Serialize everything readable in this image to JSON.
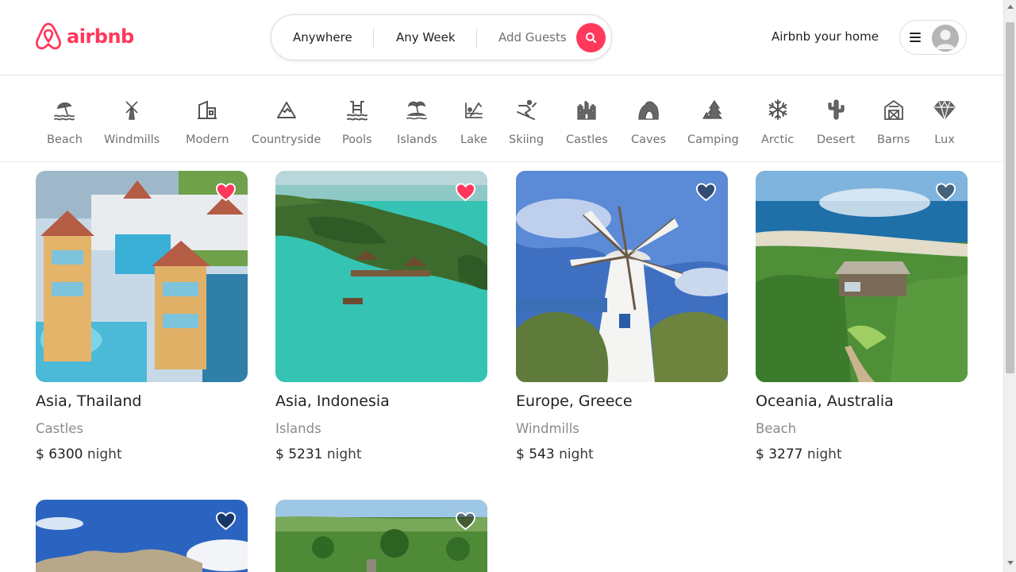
{
  "brand": {
    "name": "airbnb",
    "color": "#ff385c"
  },
  "search": {
    "where": "Anywhere",
    "when": "Any Week",
    "who": "Add Guests"
  },
  "header": {
    "host_link": "Airbnb your home"
  },
  "categories": [
    {
      "label": "Beach",
      "icon": "beach-icon"
    },
    {
      "label": "Windmills",
      "icon": "windmill-icon"
    },
    {
      "label": "Modern",
      "icon": "modern-house-icon"
    },
    {
      "label": "Countryside",
      "icon": "mountain-icon"
    },
    {
      "label": "Pools",
      "icon": "pool-icon"
    },
    {
      "label": "Islands",
      "icon": "island-icon"
    },
    {
      "label": "Lake",
      "icon": "lake-icon"
    },
    {
      "label": "Skiing",
      "icon": "skiing-icon"
    },
    {
      "label": "Castles",
      "icon": "castle-icon"
    },
    {
      "label": "Caves",
      "icon": "cave-icon"
    },
    {
      "label": "Camping",
      "icon": "camping-icon"
    },
    {
      "label": "Arctic",
      "icon": "snowflake-icon"
    },
    {
      "label": "Desert",
      "icon": "cactus-icon"
    },
    {
      "label": "Barns",
      "icon": "barn-icon"
    },
    {
      "label": "Lux",
      "icon": "diamond-icon"
    }
  ],
  "listings": [
    {
      "title": "Asia, Thailand",
      "category": "Castles",
      "price": "$ 6300",
      "unit": "night",
      "favorited": true
    },
    {
      "title": "Asia, Indonesia",
      "category": "Islands",
      "price": "$ 5231",
      "unit": "night",
      "favorited": true
    },
    {
      "title": "Europe, Greece",
      "category": "Windmills",
      "price": "$ 543",
      "unit": "night",
      "favorited": false
    },
    {
      "title": "Oceania, Australia",
      "category": "Beach",
      "price": "$ 3277",
      "unit": "night",
      "favorited": false
    },
    {
      "favorited": false
    },
    {
      "favorited": false
    }
  ]
}
